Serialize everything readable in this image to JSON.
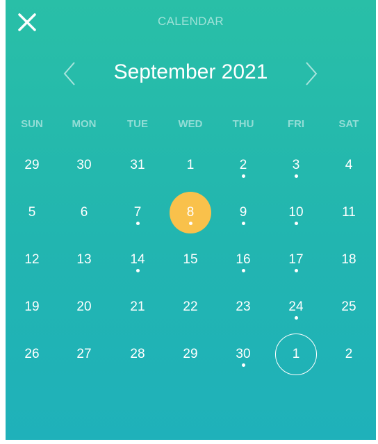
{
  "header": {
    "title": "CALENDAR",
    "close_icon": "close-icon",
    "prev_icon": "chevron-left-icon",
    "next_icon": "chevron-right-icon",
    "month_label": "September 2021"
  },
  "weekdays": [
    "SUN",
    "MON",
    "TUE",
    "WED",
    "THU",
    "FRI",
    "SAT"
  ],
  "colors": {
    "gradient_top": "#29bfa7",
    "gradient_bottom": "#1fb1ba",
    "selected": "#f9c14b",
    "text": "#ffffff"
  },
  "weeks": [
    [
      {
        "label": "29",
        "dot": false
      },
      {
        "label": "30",
        "dot": false
      },
      {
        "label": "31",
        "dot": false
      },
      {
        "label": "1",
        "dot": false
      },
      {
        "label": "2",
        "dot": true
      },
      {
        "label": "3",
        "dot": true
      },
      {
        "label": "4",
        "dot": false
      }
    ],
    [
      {
        "label": "5",
        "dot": false
      },
      {
        "label": "6",
        "dot": false
      },
      {
        "label": "7",
        "dot": true
      },
      {
        "label": "8",
        "dot": true,
        "state": "selected"
      },
      {
        "label": "9",
        "dot": true
      },
      {
        "label": "10",
        "dot": true
      },
      {
        "label": "11",
        "dot": false
      }
    ],
    [
      {
        "label": "12",
        "dot": false
      },
      {
        "label": "13",
        "dot": false
      },
      {
        "label": "14",
        "dot": true
      },
      {
        "label": "15",
        "dot": false
      },
      {
        "label": "16",
        "dot": true
      },
      {
        "label": "17",
        "dot": true
      },
      {
        "label": "18",
        "dot": false
      }
    ],
    [
      {
        "label": "19",
        "dot": false
      },
      {
        "label": "20",
        "dot": false
      },
      {
        "label": "21",
        "dot": false
      },
      {
        "label": "22",
        "dot": false
      },
      {
        "label": "23",
        "dot": false
      },
      {
        "label": "24",
        "dot": true
      },
      {
        "label": "25",
        "dot": false
      }
    ],
    [
      {
        "label": "26",
        "dot": false
      },
      {
        "label": "27",
        "dot": false
      },
      {
        "label": "28",
        "dot": false
      },
      {
        "label": "29",
        "dot": false
      },
      {
        "label": "30",
        "dot": true
      },
      {
        "label": "1",
        "dot": false,
        "state": "today"
      },
      {
        "label": "2",
        "dot": false
      }
    ]
  ]
}
